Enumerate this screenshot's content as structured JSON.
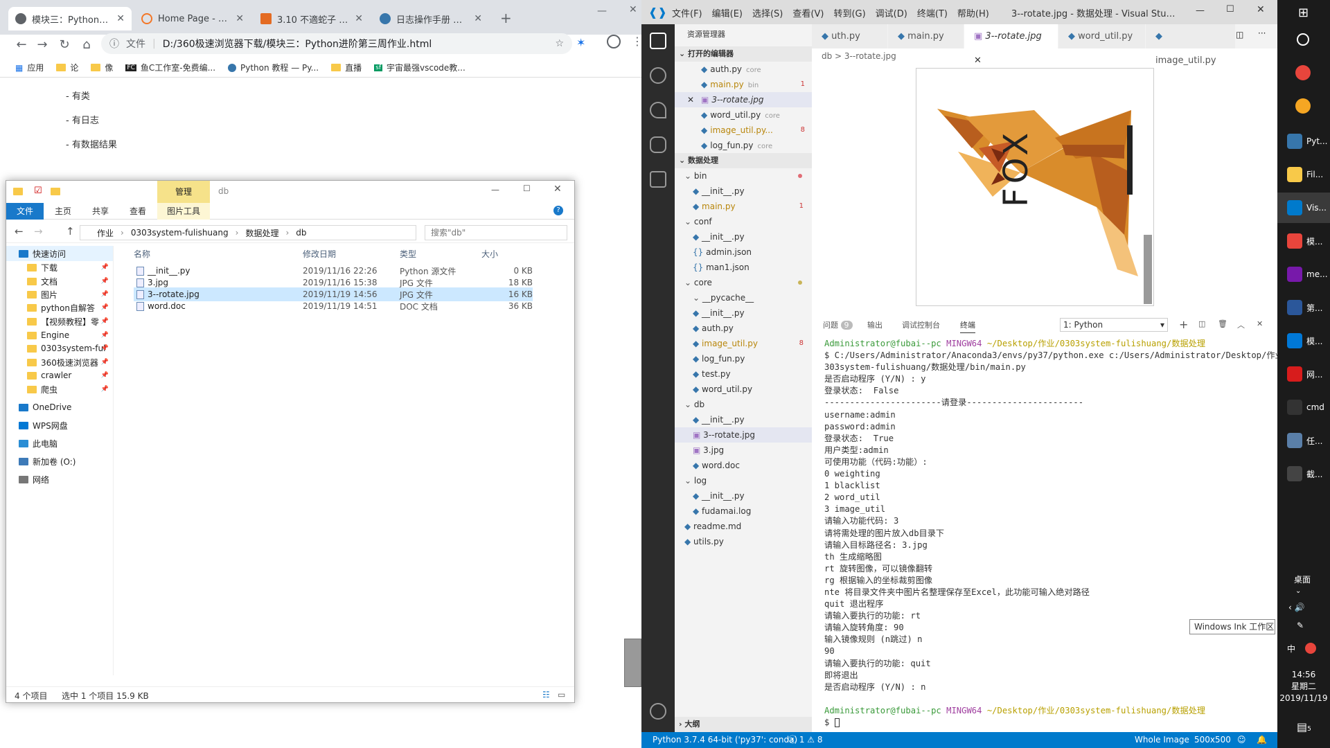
{
  "browser": {
    "tabs": [
      {
        "label": "模块三：Python进阶",
        "active": true,
        "icon_color": "#5f6368"
      },
      {
        "label": "Home Page - Selec",
        "active": false,
        "icon_color": "#f37626"
      },
      {
        "label": "3.10 不適蛇子 - Jup",
        "active": false,
        "icon_color": "#e46b22"
      },
      {
        "label": "日志操作手册 — Py",
        "active": false,
        "icon_color": "#3776ab"
      }
    ],
    "new_tab_label": "+",
    "address_prefix": "文件",
    "address": "D:/360极速浏览器下载/模块三：Python进阶第三周作业.html",
    "bookmarks": [
      "应用",
      "论",
      "像",
      "鱼C工作室-免费编...",
      "Python 教程 — Py...",
      "直播",
      "宇宙最强vscode教..."
    ],
    "page_lines": [
      "- 有类",
      "- 有日志",
      "- 有数据结果"
    ]
  },
  "explorer": {
    "title": "db",
    "manage_tab": "管理",
    "picture_tools": "图片工具",
    "ribbon_tabs": [
      "文件",
      "主页",
      "共享",
      "查看"
    ],
    "path": [
      "作业",
      "0303system-fulishuang",
      "数据处理",
      "db"
    ],
    "search_placeholder": "搜索\"db\"",
    "nav_items": [
      {
        "label": "快速访问",
        "pinned": false,
        "header": true
      },
      {
        "label": "下载",
        "pinned": true
      },
      {
        "label": "文档",
        "pinned": true
      },
      {
        "label": "图片",
        "pinned": true
      },
      {
        "label": "python自解答",
        "pinned": true
      },
      {
        "label": "【视频教程】零",
        "pinned": true
      },
      {
        "label": "Engine",
        "pinned": true
      },
      {
        "label": "0303system-ful",
        "pinned": true
      },
      {
        "label": "360极速浏览器",
        "pinned": true
      },
      {
        "label": "crawler",
        "pinned": true
      },
      {
        "label": "爬虫",
        "pinned": true
      },
      {
        "label": "OneDrive",
        "pinned": false,
        "header": true
      },
      {
        "label": "WPS网盘",
        "pinned": false,
        "header": true
      },
      {
        "label": "此电脑",
        "pinned": false,
        "header": true
      },
      {
        "label": "新加卷 (O:)",
        "pinned": false,
        "header": true
      },
      {
        "label": "网络",
        "pinned": false,
        "header": true
      }
    ],
    "columns": [
      "名称",
      "修改日期",
      "类型",
      "大小"
    ],
    "files": [
      {
        "name": "__init__.py",
        "date": "2019/11/16 22:26",
        "type": "Python 源文件",
        "size": "0 KB",
        "selected": false
      },
      {
        "name": "3.jpg",
        "date": "2019/11/16 15:38",
        "type": "JPG 文件",
        "size": "18 KB",
        "selected": false
      },
      {
        "name": "3--rotate.jpg",
        "date": "2019/11/19 14:56",
        "type": "JPG 文件",
        "size": "16 KB",
        "selected": true
      },
      {
        "name": "word.doc",
        "date": "2019/11/19 14:51",
        "type": "DOC 文档",
        "size": "36 KB",
        "selected": false
      }
    ],
    "status_count": "4 个项目",
    "status_selection": "选中 1 个项目  15.9 KB"
  },
  "vscode": {
    "menu": [
      "文件(F)",
      "编辑(E)",
      "选择(S)",
      "查看(V)",
      "转到(G)",
      "调试(D)",
      "终端(T)",
      "帮助(H)"
    ],
    "title": "3--rotate.jpg - 数据处理 - Visual Studio Code",
    "explorer_title": "资源管理器",
    "open_editors_header": "打开的编辑器",
    "open_editors": [
      {
        "name": "auth.py",
        "hint": "core",
        "badge": ""
      },
      {
        "name": "main.py",
        "hint": "bin",
        "badge": "1"
      },
      {
        "name": "3--rotate.jpg",
        "hint": "",
        "badge": ""
      },
      {
        "name": "word_util.py",
        "hint": "core",
        "badge": ""
      },
      {
        "name": "image_util.py...",
        "hint": "",
        "badge": "8"
      },
      {
        "name": "log_fun.py",
        "hint": "core",
        "badge": ""
      }
    ],
    "workspace_header": "数据处理",
    "tree": [
      {
        "name": "bin",
        "depth": 1,
        "folder": true
      },
      {
        "name": "__init__.py",
        "depth": 2
      },
      {
        "name": "main.py",
        "depth": 2,
        "badge": "1"
      },
      {
        "name": "conf",
        "depth": 1,
        "folder": true
      },
      {
        "name": "__init__.py",
        "depth": 2
      },
      {
        "name": "admin.json",
        "depth": 2
      },
      {
        "name": "man1.json",
        "depth": 2
      },
      {
        "name": "core",
        "depth": 1,
        "folder": true
      },
      {
        "name": "__pycache__",
        "depth": 2,
        "folder": true
      },
      {
        "name": "__init__.py",
        "depth": 2
      },
      {
        "name": "auth.py",
        "depth": 2
      },
      {
        "name": "image_util.py",
        "depth": 2,
        "badge": "8"
      },
      {
        "name": "log_fun.py",
        "depth": 2
      },
      {
        "name": "test.py",
        "depth": 2
      },
      {
        "name": "word_util.py",
        "depth": 2
      },
      {
        "name": "db",
        "depth": 1,
        "folder": true
      },
      {
        "name": "__init__.py",
        "depth": 2
      },
      {
        "name": "3--rotate.jpg",
        "depth": 2,
        "selected": true
      },
      {
        "name": "3.jpg",
        "depth": 2
      },
      {
        "name": "word.doc",
        "depth": 2
      },
      {
        "name": "log",
        "depth": 1,
        "folder": true
      },
      {
        "name": "__init__.py",
        "depth": 2
      },
      {
        "name": "fudamai.log",
        "depth": 2
      },
      {
        "name": "readme.md",
        "depth": 1
      },
      {
        "name": "utils.py",
        "depth": 1
      }
    ],
    "outline_header": "大纲",
    "tabs": [
      {
        "label": "uth.py",
        "active": false
      },
      {
        "label": "main.py",
        "active": false
      },
      {
        "label": "3--rotate.jpg",
        "active": true
      },
      {
        "label": "word_util.py",
        "active": false
      },
      {
        "label": "image_util.py",
        "active": false
      }
    ],
    "breadcrumb": "db  >  3--rotate.jpg",
    "image_caption": "FOX",
    "panel_tabs": [
      "问题",
      "输出",
      "调试控制台",
      "终端"
    ],
    "problems_count": "9",
    "terminal_select": "1: Python",
    "prompt_user": "Administrator@fubai--pc",
    "prompt_env": "MINGW64",
    "prompt_path": "~/Desktop/作业/0303system-fulishuang/数据处理",
    "terminal_lines": [
      "$ C:/Users/Administrator/Anaconda3/envs/py37/python.exe c:/Users/Administrator/Desktop/作业/0",
      "303system-fulishuang/数据处理/bin/main.py",
      "是否启动程序 (Y/N) : y",
      "登录状态:  False",
      "-----------------------请登录-----------------------",
      "username:admin",
      "password:admin",
      "登录状态:  True",
      "用户类型:admin",
      "可使用功能（代码:功能）:",
      "0 weighting",
      "1 blacklist",
      "2 word_util",
      "3 image_util",
      "请输入功能代码: 3",
      "请将需处理的图片放入db目录下",
      "请输入目标路径名: 3.jpg",
      "th 生成缩略图",
      "rt 旋转图像，可以镜像翻转",
      "rg 根据输入的坐标裁剪图像",
      "nte 将目录文件夹中图片名整理保存至Excel，此功能可输入绝对路径",
      "quit 退出程序",
      "请输入要执行的功能: rt",
      "请输入旋转角度: 90",
      "输入镜像规则 (n跳过) n",
      "90",
      "请输入要执行的功能: quit",
      "即将退出",
      "是否启动程序 (Y/N) : n"
    ],
    "terminal_cursor_line": "$ ",
    "status_left": "Python 3.7.4 64-bit ('py37': conda)",
    "status_problems": "ⓧ 1 ⚠ 8",
    "status_right": [
      "Whole Image",
      "500x500"
    ]
  },
  "taskbar": {
    "items": [
      {
        "label": "Pyt...",
        "color": "#3776ab"
      },
      {
        "label": "Fil...",
        "color": "#f8c949"
      },
      {
        "label": "Vis...",
        "color": "#007acc",
        "active": true
      },
      {
        "label": "模...",
        "color": "#e8453c"
      },
      {
        "label": "me...",
        "color": "#7719aa"
      },
      {
        "label": "第...",
        "color": "#2b579a"
      },
      {
        "label": "模...",
        "color": "#0078d7"
      },
      {
        "label": "网...",
        "color": "#d71c1c"
      },
      {
        "label": "cmd",
        "color": "#333333"
      },
      {
        "label": "任...",
        "color": "#5a7fa8"
      },
      {
        "label": "截...",
        "color": "#444444"
      }
    ],
    "desktop_label": "桌面",
    "ink_tooltip": "Windows Ink 工作区",
    "ime": "中",
    "time": "14:56",
    "weekday": "星期二",
    "date": "2019/11/19",
    "notif_count": "5"
  }
}
